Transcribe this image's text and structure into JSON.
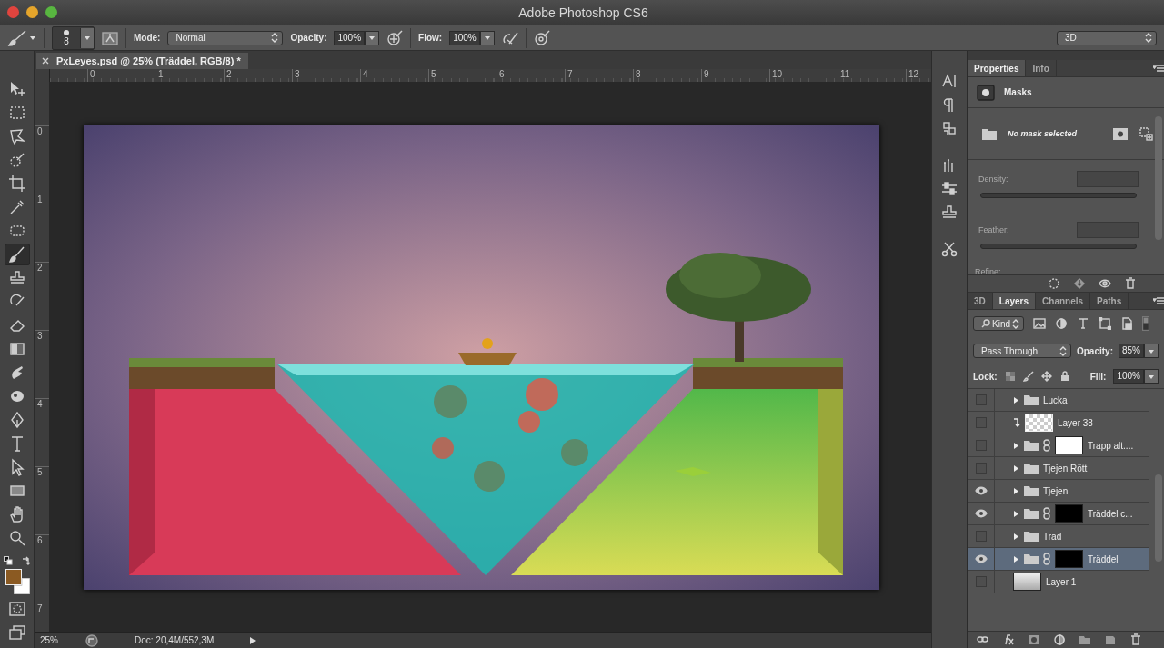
{
  "window": {
    "title": "Adobe Photoshop CS6"
  },
  "options_bar": {
    "brush_size": "8",
    "mode_label": "Mode:",
    "mode": "Normal",
    "opacity_label": "Opacity:",
    "opacity": "100%",
    "flow_label": "Flow:",
    "flow": "100%",
    "workspace": "3D"
  },
  "tools": [
    {
      "kind": "move",
      "selected": false
    },
    {
      "kind": "marquee",
      "selected": false
    },
    {
      "kind": "lasso",
      "selected": false
    },
    {
      "kind": "quick-select",
      "selected": false
    },
    {
      "kind": "crop",
      "selected": false
    },
    {
      "kind": "eyedropper",
      "selected": false
    },
    {
      "kind": "healing",
      "selected": false
    },
    {
      "kind": "brush",
      "selected": true
    },
    {
      "kind": "stamp",
      "selected": false
    },
    {
      "kind": "history-brush",
      "selected": false
    },
    {
      "kind": "eraser",
      "selected": false
    },
    {
      "kind": "gradient",
      "selected": false
    },
    {
      "kind": "smudge",
      "selected": false
    },
    {
      "kind": "sponge",
      "selected": false
    },
    {
      "kind": "pen",
      "selected": false
    },
    {
      "kind": "type",
      "selected": false
    },
    {
      "kind": "path-select",
      "selected": false
    },
    {
      "kind": "shape",
      "selected": false
    },
    {
      "kind": "hand",
      "selected": false
    },
    {
      "kind": "zoom",
      "selected": false
    }
  ],
  "color_swatches": [
    {
      "kind": "foreground",
      "color": "#8b5a22"
    },
    {
      "kind": "background",
      "color": "#ffffff"
    }
  ],
  "document_tab": {
    "title": "PxLeyes.psd @ 25% (Träddel, RGB/8) *"
  },
  "ruler_h": [
    "0",
    "1",
    "2",
    "3",
    "4",
    "5",
    "6",
    "7",
    "8",
    "9",
    "10",
    "11",
    "12"
  ],
  "ruler_v": [
    "0",
    "1",
    "2",
    "3",
    "4",
    "5",
    "6",
    "7"
  ],
  "status_bar": {
    "zoom": "25%",
    "doc": "Doc: 20,4M/552,3M"
  },
  "properties": {
    "tabs": [
      {
        "label": "Properties",
        "selected": true
      },
      {
        "label": "Info",
        "selected": false
      }
    ],
    "section": "Masks",
    "message": "No mask selected",
    "fields": [
      "Density:",
      "Feather:"
    ],
    "refine": "Refine:"
  },
  "layers_panel": {
    "tabs": [
      {
        "label": "3D",
        "selected": false
      },
      {
        "label": "Layers",
        "selected": true
      },
      {
        "label": "Channels",
        "selected": false
      },
      {
        "label": "Paths",
        "selected": false
      }
    ],
    "filter": "Kind",
    "blend_mode": "Pass Through",
    "opacity_label": "Opacity:",
    "opacity": "85%",
    "lock_label": "Lock:",
    "fill_label": "Fill:",
    "fill": "100%",
    "layers": [
      {
        "name": "Lucka",
        "kind": "group",
        "visible": false,
        "selected": false
      },
      {
        "name": "Layer 38",
        "kind": "clipped-layer",
        "visible": false,
        "selected": false
      },
      {
        "name": "Trapp alt....",
        "kind": "group",
        "mask": {
          "kind": "white"
        },
        "visible": false,
        "selected": false
      },
      {
        "name": "Tjejen Rött",
        "kind": "group",
        "visible": false,
        "selected": false
      },
      {
        "name": "Tjejen",
        "kind": "group",
        "visible": true,
        "selected": false
      },
      {
        "name": "Träddel c...",
        "kind": "group",
        "mask": {
          "kind": "black"
        },
        "visible": true,
        "selected": false
      },
      {
        "name": "Träd",
        "kind": "group",
        "visible": false,
        "selected": false
      },
      {
        "name": "Träddel",
        "kind": "group",
        "mask": {
          "kind": "black"
        },
        "visible": true,
        "selected": true
      },
      {
        "name": "Layer 1",
        "kind": "layer",
        "visible": false,
        "selected": false
      }
    ]
  }
}
